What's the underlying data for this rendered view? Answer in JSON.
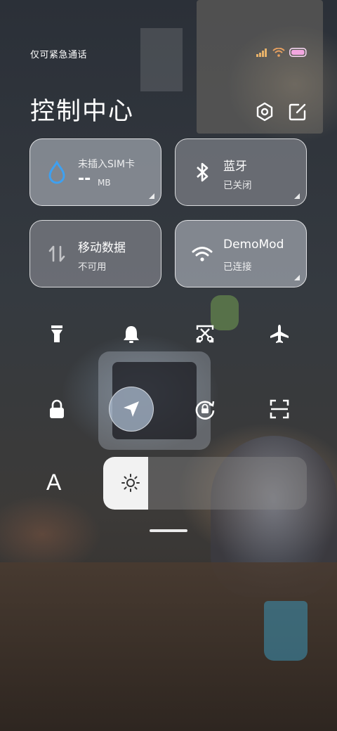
{
  "status_bar": {
    "carrier_text": "仅可紧急通话",
    "icons": [
      "signal-icon",
      "wifi-icon",
      "battery-icon"
    ],
    "battery_color": "#f2a6e0"
  },
  "header": {
    "title": "控制中心",
    "settings_icon": "gear-icon",
    "edit_icon": "edit-icon"
  },
  "tiles": [
    {
      "id": "data-usage",
      "line1": "未插入SIM卡",
      "value": "--",
      "unit": "MB",
      "icon": "water-drop-icon",
      "icon_color": "#3ea0f0"
    },
    {
      "id": "bluetooth",
      "line1": "蓝牙",
      "line2": "已关闭",
      "icon": "bluetooth-icon"
    },
    {
      "id": "mobile-data",
      "line1": "移动数据",
      "line2": "不可用",
      "icon": "data-arrows-icon"
    },
    {
      "id": "wifi",
      "line1": "DemoMod",
      "line2": "已连接",
      "icon": "wifi-icon"
    }
  ],
  "toggles_row1": [
    {
      "name": "flashlight",
      "icon": "flashlight-icon",
      "on": false
    },
    {
      "name": "sound",
      "icon": "bell-icon",
      "on": false
    },
    {
      "name": "screenshot",
      "icon": "screenshot-scissors-icon",
      "on": false
    },
    {
      "name": "airplane",
      "icon": "airplane-icon",
      "on": false
    }
  ],
  "toggles_row2": [
    {
      "name": "lock-screen",
      "icon": "lock-icon",
      "on": false
    },
    {
      "name": "location",
      "icon": "location-arrow-icon",
      "on": true
    },
    {
      "name": "auto-rotate",
      "icon": "rotation-lock-icon",
      "on": false
    },
    {
      "name": "scanner",
      "icon": "scan-icon",
      "on": false
    }
  ],
  "font_size_label": "A",
  "brightness": {
    "level": 0.22,
    "icon": "sun-icon"
  },
  "colors": {
    "tile_border": "#ffffff",
    "accent_blue": "#3ea0f0"
  }
}
